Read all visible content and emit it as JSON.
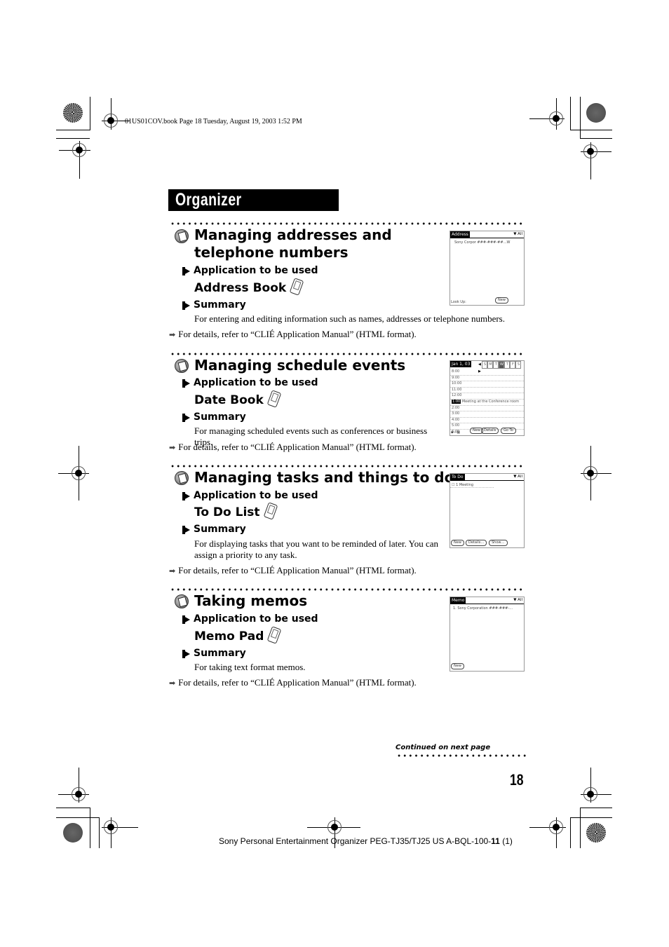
{
  "book_info": "01US01COV.book  Page 18  Tuesday, August 19, 2003  1:52 PM",
  "page_title": "Organizer",
  "labels": {
    "application": "Application to be used",
    "summary": "Summary",
    "details": "For details, refer to “CLIÉ Application Manual” (HTML format)."
  },
  "sections": [
    {
      "icon": "address-card-icon",
      "title_line1": "Managing addresses and",
      "title_line2": "telephone numbers",
      "app": "Address Book",
      "summary": "For entering and editing information such as names, addresses or telephone numbers.",
      "screen": {
        "tab": "Address",
        "category": "▼ All",
        "rows": [
          "Sony Corpor   ###-###-##…W"
        ],
        "footer_left": "Look Up:",
        "buttons": [
          "New"
        ]
      }
    },
    {
      "icon": "calendar-clock-icon",
      "title_line1": "Managing schedule events",
      "app": "Date Book",
      "summary": "For managing scheduled events such as conferences or business trips.",
      "screen": {
        "tab": "Jan 1, 03",
        "weekdays": [
          "S",
          "M",
          "T",
          "W",
          "T",
          "F",
          "S"
        ],
        "selected_day": "W",
        "times": [
          "8:00",
          "9:00",
          "10:00",
          "11:00",
          "12:00",
          "1:00",
          "2:00",
          "3:00",
          "4:00",
          "5:00",
          "6:00"
        ],
        "event_time": "1:00",
        "event_text": "Meeting at the Conference room",
        "buttons": [
          "New",
          "Details",
          "Go To"
        ]
      }
    },
    {
      "icon": "checklist-icon",
      "title_line1": "Managing tasks and things to do",
      "app": "To Do List",
      "summary": "For displaying tasks that you want to be reminded of later. You can assign a priority to any task.",
      "screen": {
        "tab": "To Do",
        "category": "▼ All",
        "rows": [
          "☐ 1  Meeting"
        ],
        "buttons": [
          "New",
          "Details…",
          "Show…"
        ]
      }
    },
    {
      "icon": "memo-pencil-icon",
      "title_line1": "Taking memos",
      "app": "Memo Pad",
      "summary": "For taking text format memos.",
      "screen": {
        "tab": "Memo",
        "category": "▼ All",
        "rows": [
          "1. Sony Corporation ###-###-…"
        ],
        "buttons": [
          "New"
        ]
      }
    }
  ],
  "continued": "Continued on next page",
  "page_number": "18",
  "footer": {
    "text": "Sony Personal Entertainment Organizer  PEG-TJ35/TJ25 US  A-BQL-100-",
    "bold": "11",
    "suffix": " (1)"
  }
}
